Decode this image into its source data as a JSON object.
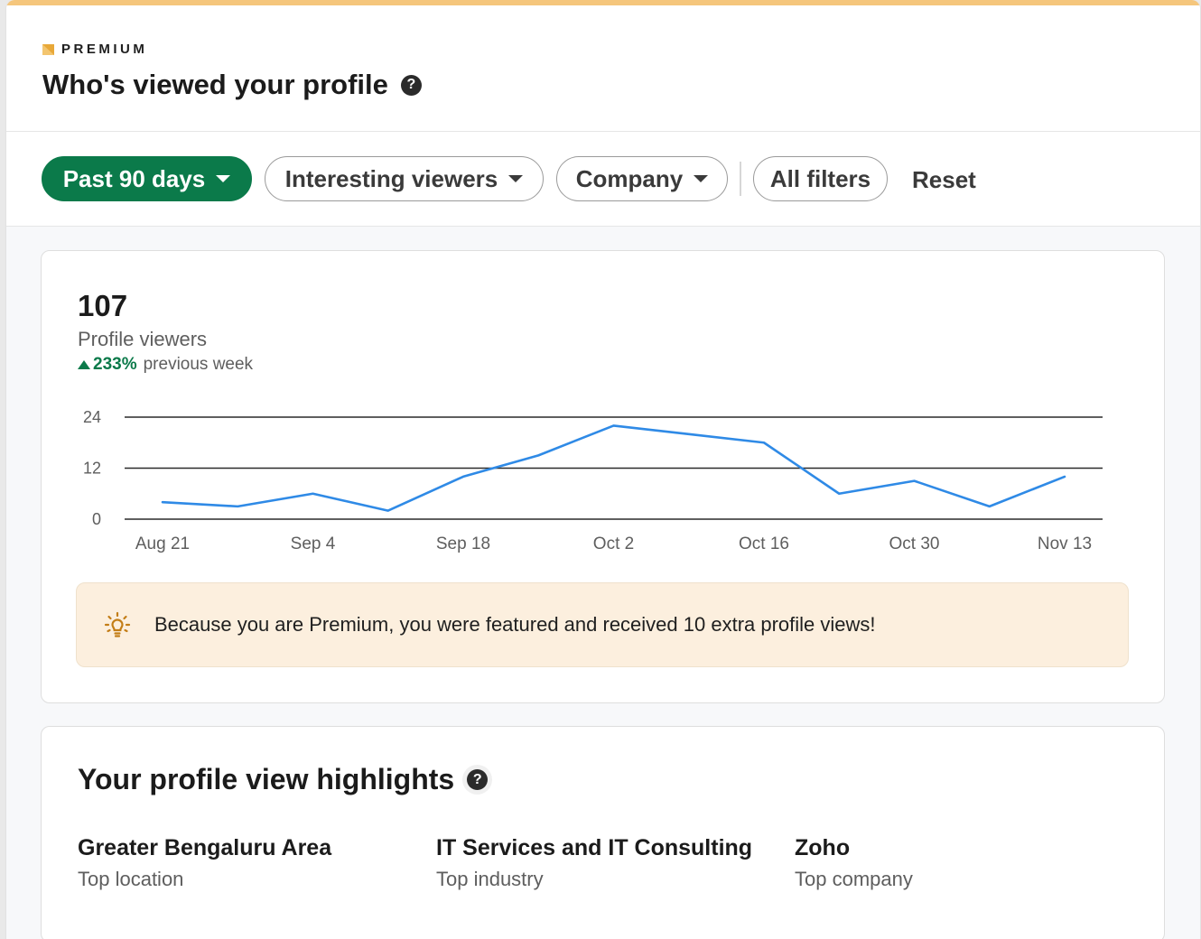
{
  "header": {
    "badge": "PREMIUM",
    "title": "Who's viewed your profile",
    "help_glyph": "?"
  },
  "filters": {
    "items": [
      {
        "label": "Past 90 days",
        "active": true,
        "dropdown": true
      },
      {
        "label": "Interesting viewers",
        "active": false,
        "dropdown": true
      },
      {
        "label": "Company",
        "active": false,
        "dropdown": true
      },
      {
        "label": "All filters",
        "active": false,
        "dropdown": false
      }
    ],
    "reset_label": "Reset"
  },
  "summary": {
    "count": "107",
    "label": "Profile viewers",
    "change": "233%",
    "change_suffix": "previous week",
    "change_direction": "up"
  },
  "chart_data": {
    "type": "line",
    "x": [
      "Aug 21",
      "Aug 28",
      "Sep 4",
      "Sep 11",
      "Sep 18",
      "Sep 25",
      "Oct 2",
      "Oct 9",
      "Oct 16",
      "Oct 23",
      "Oct 30",
      "Nov 6",
      "Nov 13"
    ],
    "xticks": [
      "Aug 21",
      "Sep 4",
      "Sep 18",
      "Oct 2",
      "Oct 16",
      "Oct 30",
      "Nov 13"
    ],
    "series": [
      {
        "values": [
          4,
          3,
          6,
          2,
          10,
          15,
          22,
          20,
          18,
          6,
          9,
          3,
          10
        ],
        "color": "#2f8ae6"
      }
    ],
    "yticks": [
      0,
      12,
      24
    ],
    "ylim": [
      0,
      24
    ],
    "grid": true,
    "title": "",
    "xlabel": "",
    "ylabel": ""
  },
  "notice": {
    "icon": "lightbulb-icon",
    "text": "Because you are Premium, you were featured and received 10 extra profile views!"
  },
  "highlights": {
    "title": "Your profile view highlights",
    "items": [
      {
        "value": "Greater Bengaluru Area",
        "label": "Top location"
      },
      {
        "value": "IT Services and IT Consulting",
        "label": "Top industry"
      },
      {
        "value": "Zoho",
        "label": "Top company"
      }
    ]
  },
  "colors": {
    "accent_green": "#0b7a4a",
    "premium_gold": "#f5c67c",
    "line_blue": "#2f8ae6",
    "notice_bg": "#fcefde"
  }
}
